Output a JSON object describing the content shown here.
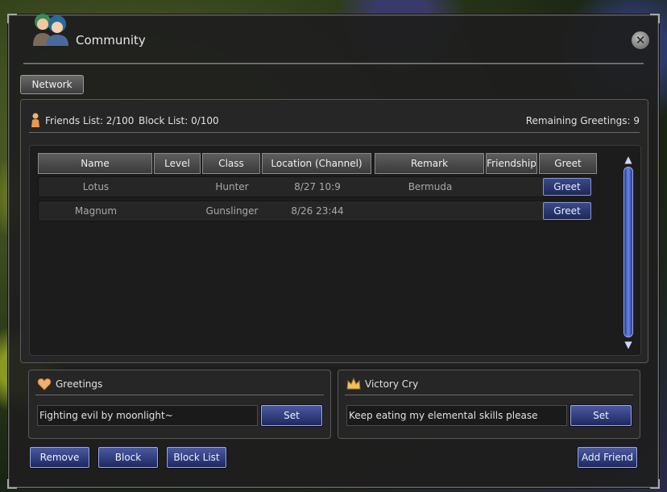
{
  "window": {
    "title": "Community"
  },
  "tabs": [
    "Network"
  ],
  "summary": {
    "friends_list": "Friends List: 2/100",
    "block_list": "Block List: 0/100",
    "remaining_greetings": "Remaining Greetings: 9"
  },
  "table": {
    "columns": [
      "Name",
      "Level",
      "Class",
      "Location (Channel)",
      "Remark",
      "Friendship",
      "Greet"
    ],
    "rows": [
      {
        "name": "Lotus",
        "level": "",
        "class": "Hunter",
        "location": "8/27 10:9",
        "remark": "Bermuda",
        "friendship": "",
        "greet": "Greet"
      },
      {
        "name": "Magnum",
        "level": "",
        "class": "Gunslinger",
        "location": "8/26 23:44",
        "remark": "",
        "friendship": "",
        "greet": "Greet"
      }
    ]
  },
  "greetings": {
    "title": "Greetings",
    "value": "Fighting evil by moonlight~",
    "set_label": "Set"
  },
  "victory_cry": {
    "title": "Victory Cry",
    "value": "Keep eating my elemental skills please",
    "set_label": "Set"
  },
  "buttons": {
    "remove": "Remove",
    "block": "Block",
    "block_list": "Block List",
    "add_friend": "Add Friend"
  },
  "colors": {
    "button_blue": "#2e3c80",
    "scrollbar_blue": "#6a86e8",
    "panel_bg": "#262626"
  }
}
